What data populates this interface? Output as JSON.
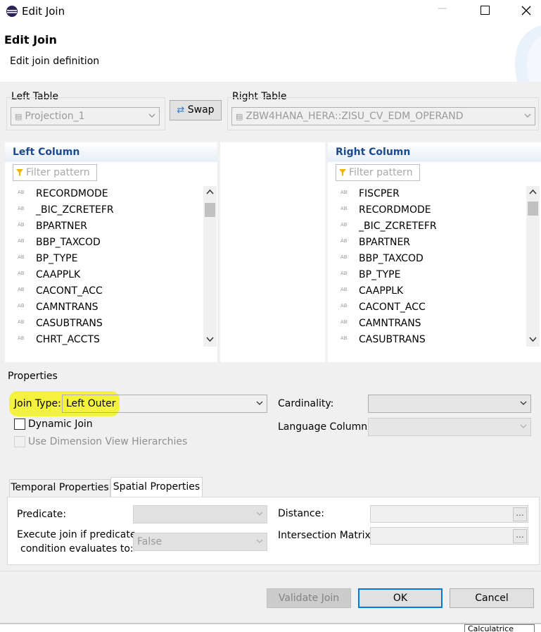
{
  "window": {
    "title": "Edit Join",
    "minimize_glyph": "—",
    "maximize_glyph": "☐",
    "close_glyph": "✕"
  },
  "header": {
    "title": "Edit Join",
    "subtitle": "Edit join definition"
  },
  "left_table": {
    "label": "Left Table",
    "value": "Projection_1"
  },
  "swap_label": "Swap",
  "right_table": {
    "label": "Right Table",
    "value": "ZBW4HANA_HERA::ZISU_CV_EDM_OPERAND"
  },
  "left_column": {
    "header": "Left Column",
    "filter_placeholder": "Filter pattern",
    "items": [
      "RECORDMODE",
      "_BIC_ZCRETEFR",
      "BPARTNER",
      "BBP_TAXCOD",
      "BP_TYPE",
      "CAAPPLK",
      "CACONT_ACC",
      "CAMNTRANS",
      "CASUBTRANS",
      "CHRT_ACCTS"
    ]
  },
  "right_column": {
    "header": "Right Column",
    "filter_placeholder": "Filter pattern",
    "items": [
      "FISCPER",
      "RECORDMODE",
      "_BIC_ZCRETEFR",
      "BPARTNER",
      "BBP_TAXCOD",
      "BP_TYPE",
      "CAAPPLK",
      "CACONT_ACC",
      "CAMNTRANS",
      "CASUBTRANS"
    ]
  },
  "item_icon_text": "AB",
  "properties": {
    "title": "Properties",
    "join_type_label": "Join Type:",
    "join_type_value": "Left Outer",
    "cardinality_label": "Cardinality:",
    "cardinality_value": "",
    "dynamic_join_label": "Dynamic Join",
    "language_column_label": "Language Column:",
    "language_column_value": "",
    "use_dimension_label": "Use Dimension View Hierarchies"
  },
  "tabs": [
    {
      "label": "Temporal Properties"
    },
    {
      "label": "Spatial Properties"
    }
  ],
  "spatial": {
    "predicate_label": "Predicate:",
    "predicate_value": "",
    "execute_label_line1": "Execute join if predicate",
    "execute_label_line2": "condition evaluates to:",
    "execute_value": "False",
    "distance_label": "Distance:",
    "intersection_label": "Intersection Matrix:",
    "ellipsis": "..."
  },
  "buttons": {
    "validate": "Validate Join",
    "ok": "OK",
    "cancel": "Cancel"
  },
  "tooltip_text": "Calculatrice",
  "colors": {
    "highlight": "#f4f22a",
    "column_header": "#1c4a8e",
    "ok_border": "#0078d7"
  }
}
